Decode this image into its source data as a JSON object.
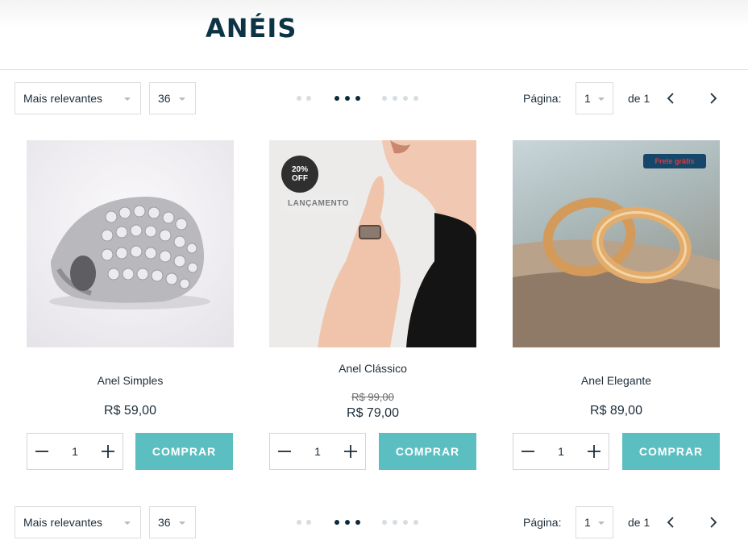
{
  "page": {
    "title": "ANÉIS"
  },
  "toolbar": {
    "sort_value": "Mais relevantes",
    "per_page_value": "36",
    "page_label": "Página:",
    "page_value": "1",
    "of_label": "de 1"
  },
  "products": [
    {
      "name": "Anel Simples",
      "price": "R$ 59,00",
      "qty": "1",
      "buy_label": "COMPRAR"
    },
    {
      "name": "Anel Clássico",
      "old_price": "R$ 99,00",
      "price": "R$ 79,00",
      "qty": "1",
      "buy_label": "COMPRAR",
      "badge_discount_pct": "20%",
      "badge_discount_off": "OFF",
      "badge_launch": "LANÇAMENTO"
    },
    {
      "name": "Anel Elegante",
      "price": "R$ 89,00",
      "qty": "1",
      "buy_label": "COMPRAR",
      "badge_shipping": "Frete grátis"
    }
  ],
  "colors": {
    "accent": "#5bbfc2",
    "title": "#0c3346",
    "active_dot": "#0e2b3c",
    "shipping_badge": "#16466a"
  },
  "icons": [
    "chevron-left-icon",
    "chevron-right-icon",
    "minus-icon",
    "plus-icon",
    "caret-down-icon"
  ]
}
